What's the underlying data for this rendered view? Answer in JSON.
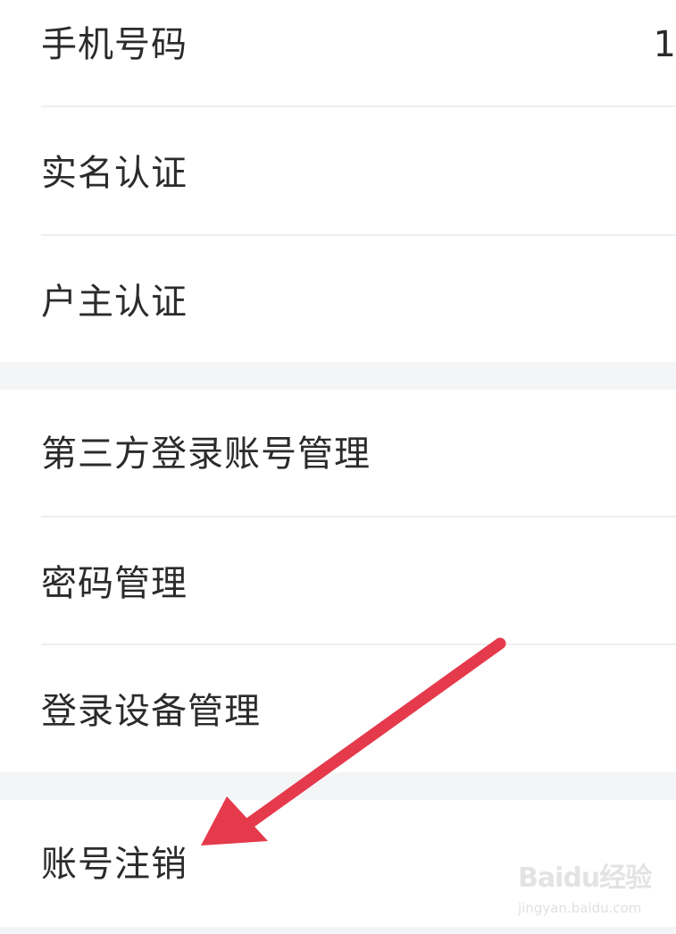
{
  "settings": {
    "group1": [
      {
        "label": "手机号码",
        "value": "1"
      },
      {
        "label": "实名认证"
      },
      {
        "label": "户主认证"
      }
    ],
    "group2": [
      {
        "label": "第三方登录账号管理"
      },
      {
        "label": "密码管理"
      },
      {
        "label": "登录设备管理"
      }
    ],
    "group3": [
      {
        "label": "账号注销"
      }
    ]
  },
  "watermark": {
    "brand": "Baidu经验",
    "url": "jingyan.baidu.com"
  },
  "colors": {
    "page_background": "#f4f5f7",
    "row_background": "#ffffff",
    "text": "#2b2b2b",
    "divider": "#eeeff1",
    "annotation_arrow": "#e53a4c"
  },
  "icons": {
    "annotation": "arrow-icon"
  }
}
